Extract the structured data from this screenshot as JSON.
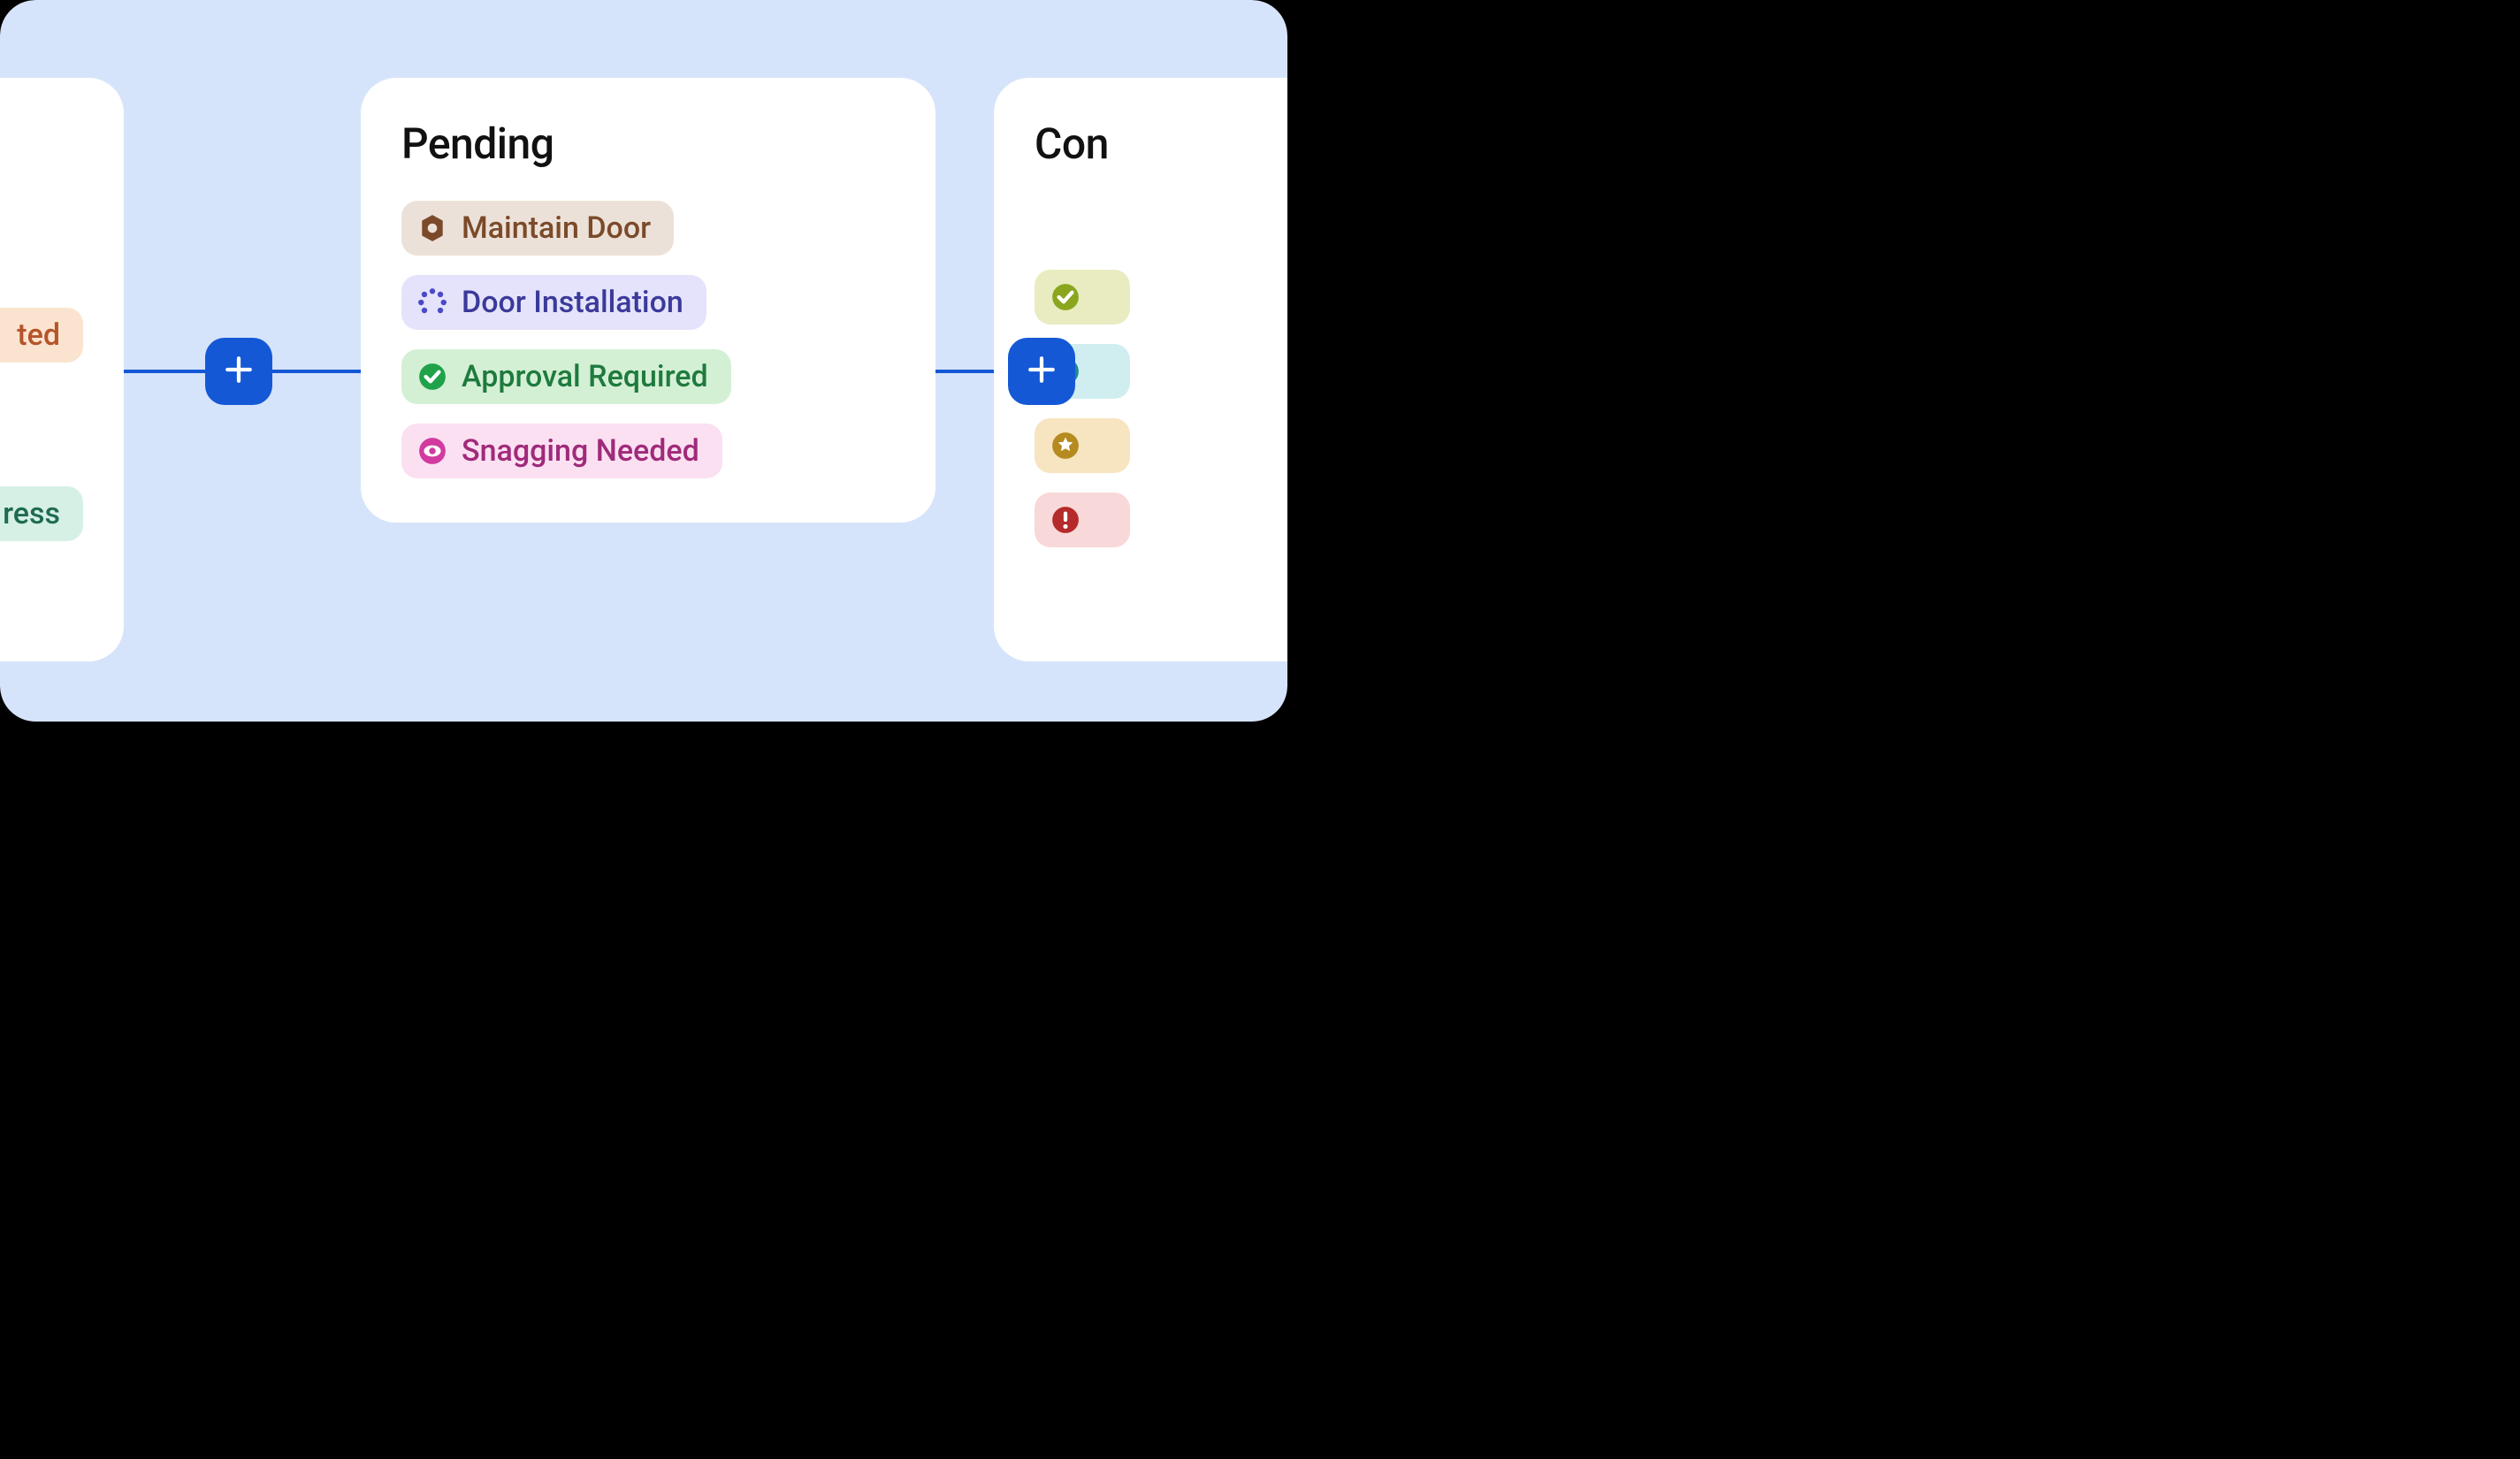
{
  "colors": {
    "accent": "#1558d6",
    "stage_bg": "#d6e4fb"
  },
  "left_column": {
    "title_fragment": "",
    "tags": [
      {
        "label_fragment": "ted",
        "theme": "orange",
        "icon": ""
      },
      {
        "label_fragment": "ress",
        "theme": "mint",
        "icon": ""
      }
    ]
  },
  "center_column": {
    "title": "Pending",
    "tags": [
      {
        "label": "Maintain Door",
        "theme": "brown",
        "icon": "nut"
      },
      {
        "label": "Door Installation",
        "theme": "indigo",
        "icon": "spinner"
      },
      {
        "label": "Approval Required",
        "theme": "green",
        "icon": "check-circle"
      },
      {
        "label": "Snagging Needed",
        "theme": "pink",
        "icon": "eye"
      }
    ]
  },
  "right_column": {
    "title_fragment": "Con",
    "tags": [
      {
        "label_fragment": "",
        "theme": "lime",
        "icon": "check-circle",
        "icon_color": "#8aa61f"
      },
      {
        "label_fragment": "",
        "theme": "teal",
        "icon": "minus-circle",
        "icon_color": "#1f8a94"
      },
      {
        "label_fragment": "",
        "theme": "amber",
        "icon": "star-circle",
        "icon_color": "#b58a1f"
      },
      {
        "label_fragment": "",
        "theme": "red",
        "icon": "alert-circle",
        "icon_color": "#b52a2a"
      }
    ]
  }
}
